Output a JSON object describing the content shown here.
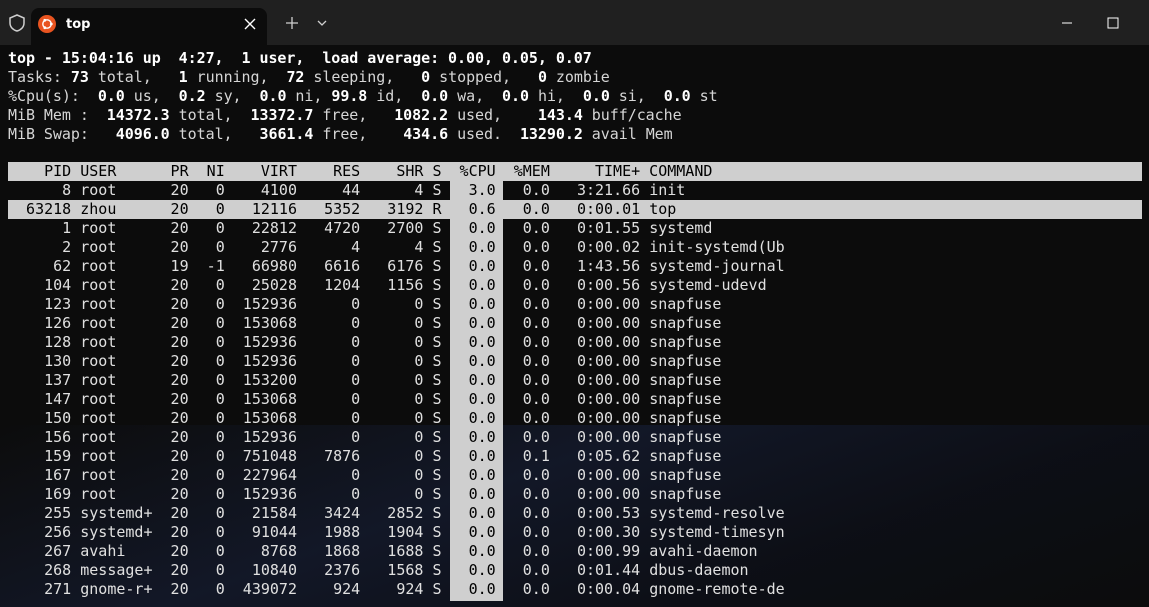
{
  "window": {
    "tab_title": "top"
  },
  "summary": {
    "line1": "top - 15:04:16 up  4:27,  1 user,  load average: 0.00, 0.05, 0.07",
    "tasks": {
      "total": "73",
      "running": "1",
      "sleeping": "72",
      "stopped": "0",
      "zombie": "0"
    },
    "cpu": {
      "us": "0.0",
      "sy": "0.2",
      "ni": "0.0",
      "id": "99.8",
      "wa": "0.0",
      "hi": "0.0",
      "si": "0.0",
      "st": "0.0"
    },
    "mem": {
      "total": "14372.3",
      "free": "13372.7",
      "used": "1082.2",
      "buff_cache": "143.4"
    },
    "swap": {
      "total": "4096.0",
      "free": "3661.4",
      "used": "434.6",
      "avail_mem": "13290.2"
    }
  },
  "columns": [
    "PID",
    "USER",
    "PR",
    "NI",
    "VIRT",
    "RES",
    "SHR",
    "S",
    "%CPU",
    "%MEM",
    "TIME+",
    "COMMAND"
  ],
  "selected_pid": "63218",
  "processes": [
    {
      "pid": "8",
      "user": "root",
      "pr": "20",
      "ni": "0",
      "virt": "4100",
      "res": "44",
      "shr": "4",
      "s": "S",
      "cpu": "3.0",
      "mem": "0.0",
      "time": "3:21.66",
      "cmd": "init"
    },
    {
      "pid": "63218",
      "user": "zhou",
      "pr": "20",
      "ni": "0",
      "virt": "12116",
      "res": "5352",
      "shr": "3192",
      "s": "R",
      "cpu": "0.6",
      "mem": "0.0",
      "time": "0:00.01",
      "cmd": "top"
    },
    {
      "pid": "1",
      "user": "root",
      "pr": "20",
      "ni": "0",
      "virt": "22812",
      "res": "4720",
      "shr": "2700",
      "s": "S",
      "cpu": "0.0",
      "mem": "0.0",
      "time": "0:01.55",
      "cmd": "systemd"
    },
    {
      "pid": "2",
      "user": "root",
      "pr": "20",
      "ni": "0",
      "virt": "2776",
      "res": "4",
      "shr": "4",
      "s": "S",
      "cpu": "0.0",
      "mem": "0.0",
      "time": "0:00.02",
      "cmd": "init-systemd(Ub"
    },
    {
      "pid": "62",
      "user": "root",
      "pr": "19",
      "ni": "-1",
      "virt": "66980",
      "res": "6616",
      "shr": "6176",
      "s": "S",
      "cpu": "0.0",
      "mem": "0.0",
      "time": "1:43.56",
      "cmd": "systemd-journal"
    },
    {
      "pid": "104",
      "user": "root",
      "pr": "20",
      "ni": "0",
      "virt": "25028",
      "res": "1204",
      "shr": "1156",
      "s": "S",
      "cpu": "0.0",
      "mem": "0.0",
      "time": "0:00.56",
      "cmd": "systemd-udevd"
    },
    {
      "pid": "123",
      "user": "root",
      "pr": "20",
      "ni": "0",
      "virt": "152936",
      "res": "0",
      "shr": "0",
      "s": "S",
      "cpu": "0.0",
      "mem": "0.0",
      "time": "0:00.00",
      "cmd": "snapfuse"
    },
    {
      "pid": "126",
      "user": "root",
      "pr": "20",
      "ni": "0",
      "virt": "153068",
      "res": "0",
      "shr": "0",
      "s": "S",
      "cpu": "0.0",
      "mem": "0.0",
      "time": "0:00.00",
      "cmd": "snapfuse"
    },
    {
      "pid": "128",
      "user": "root",
      "pr": "20",
      "ni": "0",
      "virt": "152936",
      "res": "0",
      "shr": "0",
      "s": "S",
      "cpu": "0.0",
      "mem": "0.0",
      "time": "0:00.00",
      "cmd": "snapfuse"
    },
    {
      "pid": "130",
      "user": "root",
      "pr": "20",
      "ni": "0",
      "virt": "152936",
      "res": "0",
      "shr": "0",
      "s": "S",
      "cpu": "0.0",
      "mem": "0.0",
      "time": "0:00.00",
      "cmd": "snapfuse"
    },
    {
      "pid": "137",
      "user": "root",
      "pr": "20",
      "ni": "0",
      "virt": "153200",
      "res": "0",
      "shr": "0",
      "s": "S",
      "cpu": "0.0",
      "mem": "0.0",
      "time": "0:00.00",
      "cmd": "snapfuse"
    },
    {
      "pid": "147",
      "user": "root",
      "pr": "20",
      "ni": "0",
      "virt": "153068",
      "res": "0",
      "shr": "0",
      "s": "S",
      "cpu": "0.0",
      "mem": "0.0",
      "time": "0:00.00",
      "cmd": "snapfuse"
    },
    {
      "pid": "150",
      "user": "root",
      "pr": "20",
      "ni": "0",
      "virt": "153068",
      "res": "0",
      "shr": "0",
      "s": "S",
      "cpu": "0.0",
      "mem": "0.0",
      "time": "0:00.00",
      "cmd": "snapfuse"
    },
    {
      "pid": "156",
      "user": "root",
      "pr": "20",
      "ni": "0",
      "virt": "152936",
      "res": "0",
      "shr": "0",
      "s": "S",
      "cpu": "0.0",
      "mem": "0.0",
      "time": "0:00.00",
      "cmd": "snapfuse"
    },
    {
      "pid": "159",
      "user": "root",
      "pr": "20",
      "ni": "0",
      "virt": "751048",
      "res": "7876",
      "shr": "0",
      "s": "S",
      "cpu": "0.0",
      "mem": "0.1",
      "time": "0:05.62",
      "cmd": "snapfuse"
    },
    {
      "pid": "167",
      "user": "root",
      "pr": "20",
      "ni": "0",
      "virt": "227964",
      "res": "0",
      "shr": "0",
      "s": "S",
      "cpu": "0.0",
      "mem": "0.0",
      "time": "0:00.00",
      "cmd": "snapfuse"
    },
    {
      "pid": "169",
      "user": "root",
      "pr": "20",
      "ni": "0",
      "virt": "152936",
      "res": "0",
      "shr": "0",
      "s": "S",
      "cpu": "0.0",
      "mem": "0.0",
      "time": "0:00.00",
      "cmd": "snapfuse"
    },
    {
      "pid": "255",
      "user": "systemd+",
      "pr": "20",
      "ni": "0",
      "virt": "21584",
      "res": "3424",
      "shr": "2852",
      "s": "S",
      "cpu": "0.0",
      "mem": "0.0",
      "time": "0:00.53",
      "cmd": "systemd-resolve"
    },
    {
      "pid": "256",
      "user": "systemd+",
      "pr": "20",
      "ni": "0",
      "virt": "91044",
      "res": "1988",
      "shr": "1904",
      "s": "S",
      "cpu": "0.0",
      "mem": "0.0",
      "time": "0:00.30",
      "cmd": "systemd-timesyn"
    },
    {
      "pid": "267",
      "user": "avahi",
      "pr": "20",
      "ni": "0",
      "virt": "8768",
      "res": "1868",
      "shr": "1688",
      "s": "S",
      "cpu": "0.0",
      "mem": "0.0",
      "time": "0:00.99",
      "cmd": "avahi-daemon"
    },
    {
      "pid": "268",
      "user": "message+",
      "pr": "20",
      "ni": "0",
      "virt": "10840",
      "res": "2376",
      "shr": "1568",
      "s": "S",
      "cpu": "0.0",
      "mem": "0.0",
      "time": "0:01.44",
      "cmd": "dbus-daemon"
    },
    {
      "pid": "271",
      "user": "gnome-r+",
      "pr": "20",
      "ni": "0",
      "virt": "439072",
      "res": "924",
      "shr": "924",
      "s": "S",
      "cpu": "0.0",
      "mem": "0.0",
      "time": "0:00.04",
      "cmd": "gnome-remote-de"
    }
  ]
}
